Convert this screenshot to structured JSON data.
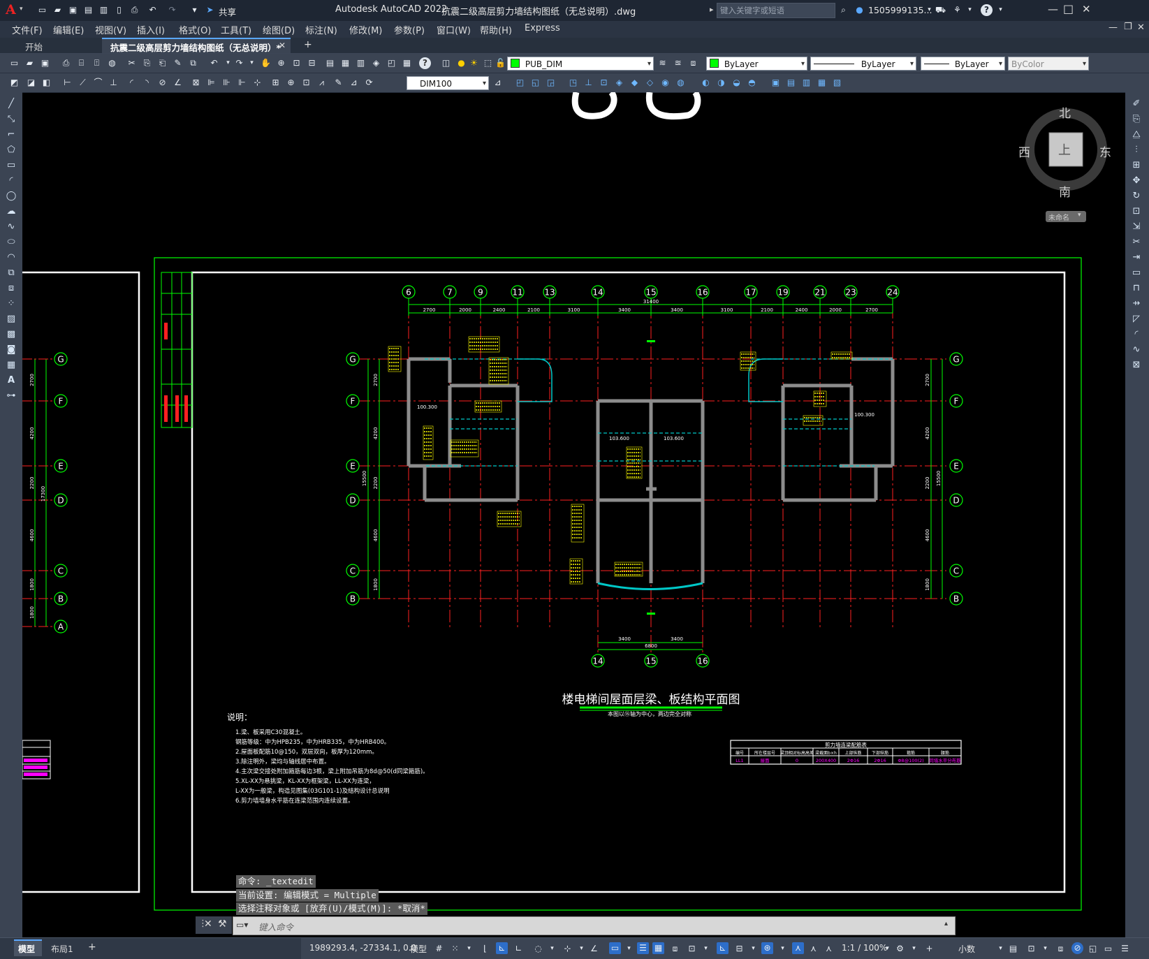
{
  "app": {
    "logo": "A",
    "title": "Autodesk AutoCAD 2022",
    "file": "抗震二级高层剪力墙结构图纸（无总说明）.dwg",
    "share": "共享",
    "search_placeholder": "键入关键字或短语",
    "user": "1505999135...",
    "icon_names": [
      "new-icon",
      "open-icon",
      "save-icon",
      "saveas-icon",
      "print-icon",
      "undo-icon",
      "redo-icon",
      "search-icon",
      "user-icon",
      "cart-icon",
      "help-icon"
    ]
  },
  "window_controls": {
    "minimize": "—",
    "maximize": "□",
    "close": "✕"
  },
  "menu": [
    "文件(F)",
    "编辑(E)",
    "视图(V)",
    "插入(I)",
    "格式(O)",
    "工具(T)",
    "绘图(D)",
    "标注(N)",
    "修改(M)",
    "参数(P)",
    "窗口(W)",
    "帮助(H)",
    "Express"
  ],
  "tabs": {
    "start": "开始",
    "active": "抗震二级高层剪力墙结构图纸（无总说明）*",
    "add": "+"
  },
  "toolbar": {
    "layer": "PUB_DIM",
    "color": "ByLayer",
    "linetype": "ByLayer",
    "lineweight": "ByLayer",
    "plotstyle": "ByColor",
    "dimstyle": "DIM100"
  },
  "viewcube": {
    "north": "北",
    "south": "南",
    "east": "东",
    "west": "西",
    "top": "上",
    "wcs": "未命名"
  },
  "drawing": {
    "title": "楼电梯间屋面层梁、板结构平面图",
    "subtitle": "本图以⑮轴为中心，两边完全对称",
    "axes_top": [
      "6",
      "7",
      "9",
      "11",
      "13",
      "14",
      "15",
      "16",
      "17",
      "19",
      "21",
      "23",
      "24"
    ],
    "dims_top": [
      "2700",
      "2000",
      "2400",
      "2100",
      "3100",
      "3400",
      "3400",
      "3100",
      "2100",
      "2400",
      "2000",
      "2700"
    ],
    "total_top": "31400",
    "axes_left": [
      "G",
      "F",
      "E",
      "D",
      "C",
      "B"
    ],
    "dims_left": [
      "2700",
      "4200",
      "2200",
      "4600",
      "1800"
    ],
    "total_left": "15500",
    "far_left_axes": [
      "G",
      "F",
      "E",
      "D",
      "C",
      "B",
      "A"
    ],
    "far_left_dims": [
      "2700",
      "4200",
      "2200",
      "4600",
      "1800",
      "1800"
    ],
    "far_left_total": "17300",
    "axes_bottom": [
      "14",
      "15",
      "16"
    ],
    "dims_bottom": [
      "3400",
      "3400"
    ],
    "total_bottom": "6800",
    "room_labels": [
      "100.300",
      "103.600",
      "103.600",
      "100.300"
    ],
    "notes_title": "说明：",
    "notes": [
      "1.梁、板采用C30混凝土。",
      "  钢筋等级：中为HPB235，中为HRB335，中为HRB400。",
      "2.屋面板配筋10@150，双层双向，板厚为120mm。",
      "3.除注明外，梁均与轴线居中布置。",
      "4.主次梁交接处附加箍筋每边3根，梁上附加吊筋为8d@50(d同梁箍筋)。",
      "5.XL-XX为悬挑梁，KL-XX为框架梁，LL-XX为连梁，",
      "  L-XX为一般梁，构造见图集(03G101-1)及结构设计总说明",
      "6.剪力墙墙身水平筋在连梁范围内连续设置。"
    ],
    "table_title": "剪力墙连梁配筋表",
    "table_headers": [
      "编号",
      "所在楼层号",
      "梁顶相对标高高差",
      "梁截面b×h",
      "上部纵筋",
      "下部纵筋",
      "箍筋",
      "腰筋"
    ],
    "table_row": [
      "LL1",
      "屋面",
      "0",
      "200X400",
      "2Φ16",
      "2Φ16",
      "Φ8@100(2)",
      "同墙水平分布筋"
    ]
  },
  "command": {
    "history": [
      "命令: _textedit",
      "当前设置: 编辑模式 = Multiple",
      "选择注释对象或 [放弃(U)/模式(M)]: *取消*"
    ],
    "placeholder": "键入命令"
  },
  "status": {
    "tab_model": "模型",
    "tab_layout": "布局1",
    "coords": "1989293.4, -27334.1, 0.0",
    "space": "模型",
    "scale": "1:1 / 100%",
    "units": "小数"
  },
  "colors": {
    "bg": "#000000",
    "titlebar": "#1e2633",
    "toolbar": "#3b4453",
    "axis": "#00ff00",
    "wall": "#8c8c8c",
    "beam": "#00c8c8",
    "grid": "#ff2020",
    "text": "#ffff00",
    "white": "#ffffff",
    "magenta": "#ff00ff"
  }
}
